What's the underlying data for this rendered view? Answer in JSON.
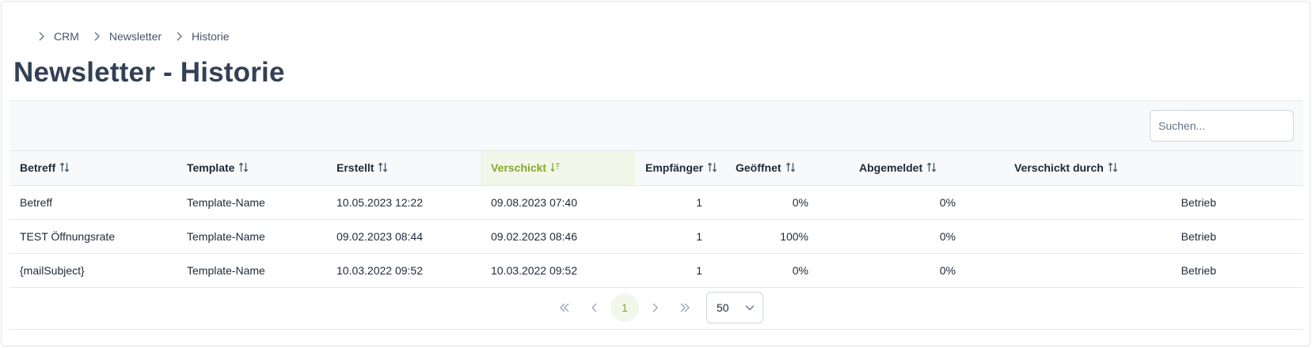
{
  "breadcrumb": {
    "items": [
      "CRM",
      "Newsletter",
      "Historie"
    ]
  },
  "page": {
    "title": "Newsletter - Historie"
  },
  "search": {
    "placeholder": "Suchen..."
  },
  "table": {
    "columns": [
      {
        "label": "Betreff",
        "sort": "none"
      },
      {
        "label": "Template",
        "sort": "none"
      },
      {
        "label": "Erstellt",
        "sort": "none"
      },
      {
        "label": "Verschickt",
        "sort": "desc"
      },
      {
        "label": "Empfänger",
        "sort": "none"
      },
      {
        "label": "Geöffnet",
        "sort": "none"
      },
      {
        "label": "Abgemeldet",
        "sort": "none"
      },
      {
        "label": "Verschickt durch",
        "sort": "none"
      }
    ],
    "rows": [
      [
        "Betreff",
        "Template-Name",
        "10.05.2023 12:22",
        "09.08.2023 07:40",
        "1",
        "0%",
        "0%",
        "Betrieb"
      ],
      [
        "TEST Öffnungsrate",
        "Template-Name",
        "09.02.2023 08:44",
        "09.02.2023 08:46",
        "1",
        "100%",
        "0%",
        "Betrieb"
      ],
      [
        "{mailSubject}",
        "Template-Name",
        "10.03.2022 09:52",
        "10.03.2022 09:52",
        "1",
        "0%",
        "0%",
        "Betrieb"
      ]
    ]
  },
  "pagination": {
    "current_page": "1",
    "rows_per_page": "50"
  },
  "colors": {
    "accent": "#84a82a",
    "accent_bg": "#f3f7ea",
    "header_bg": "#f8f9fb",
    "text": "#334155"
  }
}
